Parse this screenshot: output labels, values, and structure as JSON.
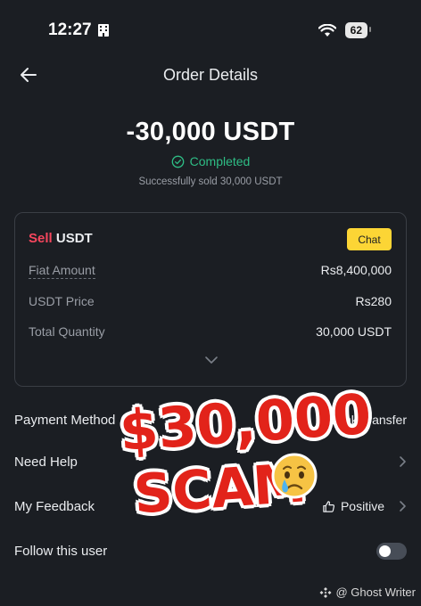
{
  "status_bar": {
    "time": "12:27",
    "battery": "62"
  },
  "header": {
    "title": "Order Details"
  },
  "summary": {
    "amount": "-30,000 USDT",
    "status": "Completed",
    "subtext": "Successfully sold 30,000 USDT"
  },
  "card": {
    "side": "Sell",
    "asset": "USDT",
    "chat_label": "Chat",
    "rows": [
      {
        "label": "Fiat Amount",
        "value": "Rs8,400,000"
      },
      {
        "label": "USDT Price",
        "value": "Rs280"
      },
      {
        "label": "Total Quantity",
        "value": "30,000 USDT"
      }
    ]
  },
  "list": {
    "payment_method_label": "Payment Method",
    "payment_method_value": "Bank Transfer",
    "need_help_label": "Need Help",
    "feedback_label": "My Feedback",
    "feedback_value": "Positive",
    "follow_label": "Follow this user"
  },
  "overlay": {
    "line1": "$30,000",
    "line2": "SCAM"
  },
  "watermark": {
    "text": "@ Ghost Writer"
  },
  "colors": {
    "accent": "#fcd535",
    "success": "#2ebd85",
    "sell": "#f6465d",
    "background": "#1b1e23"
  }
}
